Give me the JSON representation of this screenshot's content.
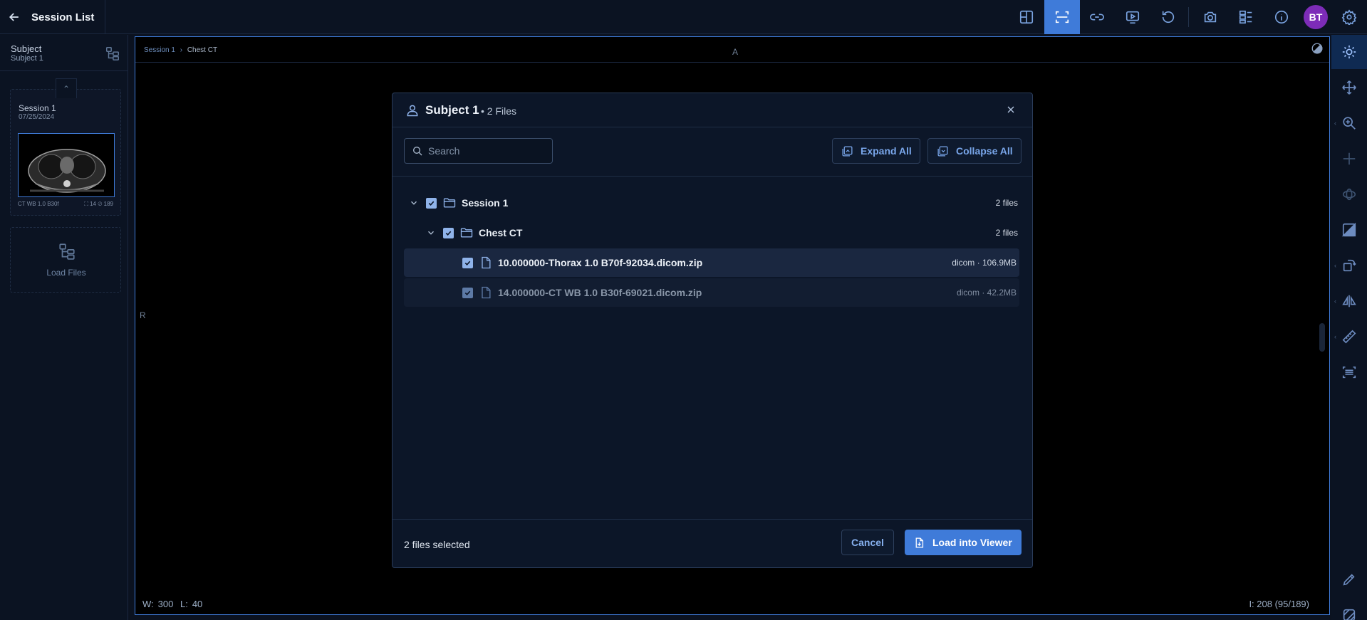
{
  "header": {
    "back_label": "Session List"
  },
  "toolbar": {
    "buttons": [
      {
        "name": "layout-icon"
      },
      {
        "name": "viewport-select-icon"
      },
      {
        "name": "link-icon"
      },
      {
        "name": "cine-icon"
      },
      {
        "name": "reset-icon"
      },
      {
        "name": "camera-icon"
      },
      {
        "name": "series-panel-icon"
      },
      {
        "name": "info-icon"
      }
    ],
    "avatar_initials": "BT"
  },
  "sidebar": {
    "subject_title": "Subject",
    "subject_name": "Subject 1",
    "session": {
      "title": "Session 1",
      "date": "07/25/2024",
      "series_label": "CT WB 1.0 B30f",
      "count_a": "14",
      "count_b": "189"
    },
    "load_files_label": "Load Files"
  },
  "viewport": {
    "breadcrumb_session": "Session 1",
    "breadcrumb_sep": "›",
    "breadcrumb_series": "Chest CT",
    "orientation_top": "A",
    "orientation_left": "R",
    "window_label": "W:",
    "window_value": "300",
    "level_label": "L:",
    "level_value": "40",
    "slice_info": "I: 208 (95/189)"
  },
  "modal": {
    "title": "Subject 1",
    "file_count": "• 2 Files",
    "search_placeholder": "Search",
    "expand_all": "Expand All",
    "collapse_all": "Collapse All",
    "tree": {
      "session": {
        "name": "Session 1",
        "count": "2 files"
      },
      "series": {
        "name": "Chest CT",
        "count": "2 files"
      },
      "files": [
        {
          "name": "10.000000-Thorax 1.0 B70f-92034.dicom.zip",
          "meta": "dicom · 106.9MB"
        },
        {
          "name": "14.000000-CT WB 1.0 B30f-69021.dicom.zip",
          "meta": "dicom · 42.2MB"
        }
      ]
    },
    "selected_text": "2 files selected",
    "cancel_label": "Cancel",
    "load_label": "Load into Viewer"
  },
  "colors": {
    "accent": "#3f7bd9",
    "avatar": "#7d2cb8",
    "background": "#0b1322"
  }
}
